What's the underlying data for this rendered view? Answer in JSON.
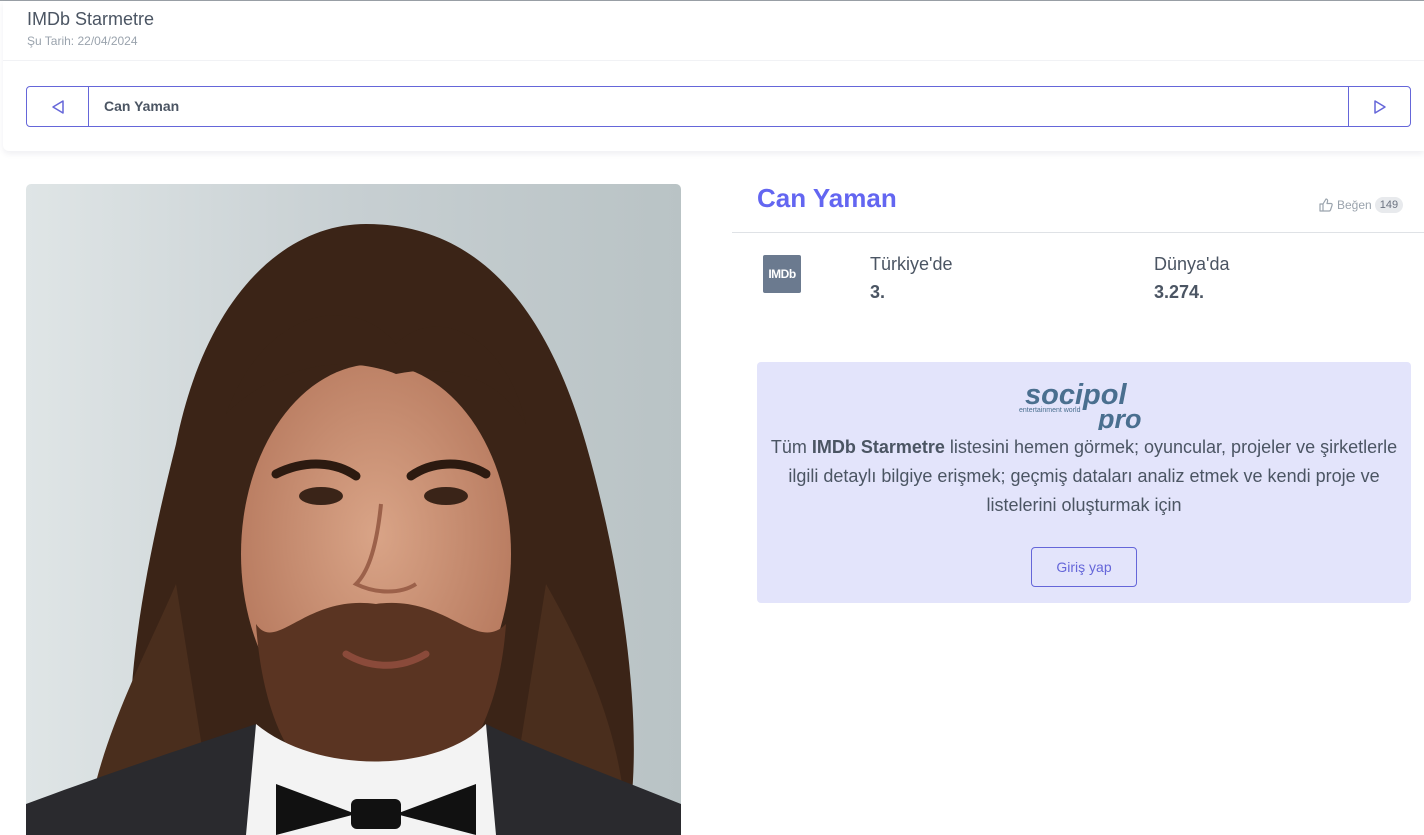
{
  "header": {
    "title": "IMDb Starmetre",
    "date": "Şu Tarih: 22/04/2024"
  },
  "nav": {
    "current_name": "Can Yaman"
  },
  "profile": {
    "name": "Can Yaman",
    "like_label": "Beğen",
    "like_count": "149",
    "source_logo_text": "IMDb",
    "turkey_label": "Türkiye'de",
    "turkey_rank": "3.",
    "world_label": "Dünya'da",
    "world_rank": "3.274."
  },
  "promo": {
    "logo_main": "socipol",
    "logo_pro": "pro",
    "logo_tagline": "entertainment world",
    "text_before": "Tüm ",
    "text_bold": "IMDb Starmetre",
    "text_after": " listesini hemen görmek; oyuncular, projeler ve şirketlerle ilgili detaylı bilgiye erişmek; geçmiş dataları analiz etmek ve kendi proje ve listelerini oluşturmak için",
    "button_label": "Giriş yap"
  },
  "colors": {
    "accent": "#6366f1",
    "border_accent": "#6566d9",
    "promo_bg": "#e3e4fb",
    "logo_blue": "#4a6f8f"
  }
}
